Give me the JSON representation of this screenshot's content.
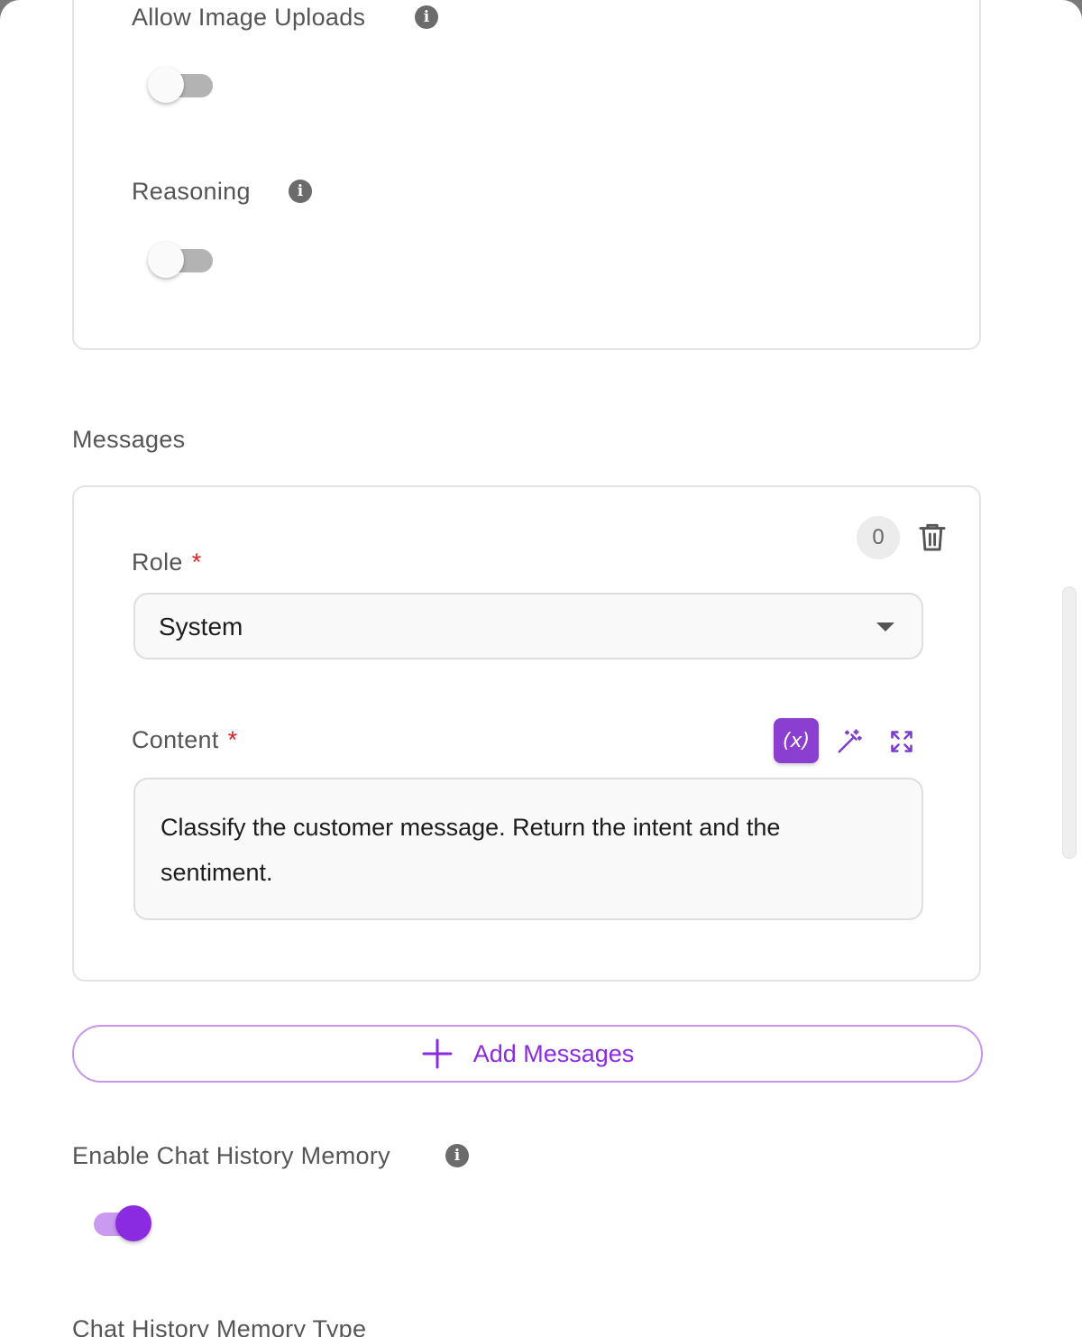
{
  "options": {
    "allow_image_uploads": {
      "label": "Allow Image Uploads",
      "enabled": false,
      "info_icon": "info-icon"
    },
    "reasoning": {
      "label": "Reasoning",
      "enabled": false,
      "info_icon": "info-icon"
    }
  },
  "messages": {
    "section_label": "Messages",
    "items": [
      {
        "index": "0",
        "role_label": "Role",
        "role_value": "System",
        "content_label": "Content",
        "content_value": "Classify the customer message. Return the intent and the sentiment.",
        "required_marker": "*",
        "variable_button_label": "(x)"
      }
    ],
    "add_button_label": "Add Messages"
  },
  "chat_history": {
    "enable_label": "Enable Chat History Memory",
    "enabled": true,
    "memory_type_label": "Chat History Memory Type"
  },
  "colors": {
    "accent": "#8a2be2",
    "required": "#e01e1e"
  }
}
